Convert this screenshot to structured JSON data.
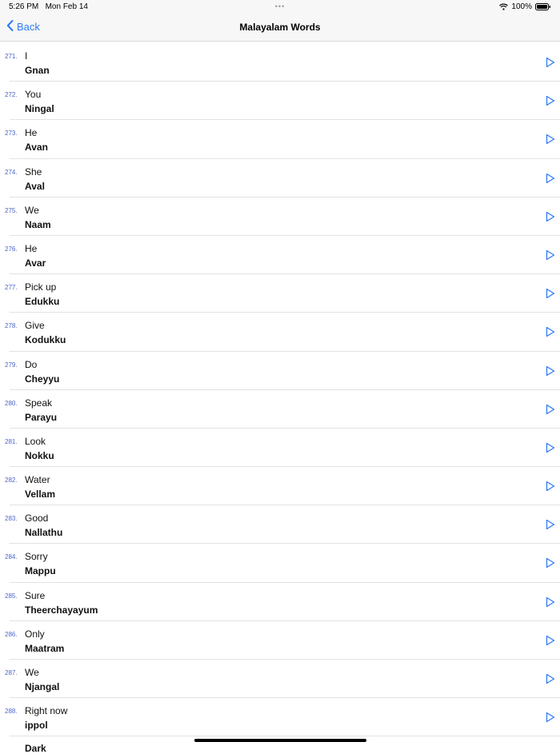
{
  "status": {
    "time": "5:26 PM",
    "date": "Mon Feb 14",
    "dots": "•••",
    "battery_text": "100%",
    "wifi_icon": "wifi-icon",
    "battery_icon": "battery-icon"
  },
  "nav": {
    "back_label": "Back",
    "title": "Malayalam Words",
    "accent": "#2f7bf5"
  },
  "words": [
    {
      "number": "271.",
      "english": "I",
      "malayalam": "Gnan"
    },
    {
      "number": "272.",
      "english": "You",
      "malayalam": "Ningal"
    },
    {
      "number": "273.",
      "english": "He",
      "malayalam": "Avan"
    },
    {
      "number": "274.",
      "english": "She",
      "malayalam": "Aval"
    },
    {
      "number": "275.",
      "english": "We",
      "malayalam": "Naam"
    },
    {
      "number": "276.",
      "english": "He",
      "malayalam": "Avar"
    },
    {
      "number": "277.",
      "english": "Pick up",
      "malayalam": "Edukku"
    },
    {
      "number": "278.",
      "english": "Give",
      "malayalam": "Kodukku"
    },
    {
      "number": "279.",
      "english": "Do",
      "malayalam": "Cheyyu"
    },
    {
      "number": "280.",
      "english": "Speak",
      "malayalam": "Parayu"
    },
    {
      "number": "281.",
      "english": "Look",
      "malayalam": "Nokku"
    },
    {
      "number": "282.",
      "english": "Water",
      "malayalam": "Vellam"
    },
    {
      "number": "283.",
      "english": "Good",
      "malayalam": "Nallathu"
    },
    {
      "number": "284.",
      "english": "Sorry",
      "malayalam": "Mappu"
    },
    {
      "number": "285.",
      "english": "Sure",
      "malayalam": "Theerchayayum"
    },
    {
      "number": "286.",
      "english": "Only",
      "malayalam": "Maatram"
    },
    {
      "number": "287.",
      "english": "We",
      "malayalam": "Njangal"
    },
    {
      "number": "288.",
      "english": "Right now",
      "malayalam": "ippol"
    }
  ],
  "partial_row_text": "Dark"
}
